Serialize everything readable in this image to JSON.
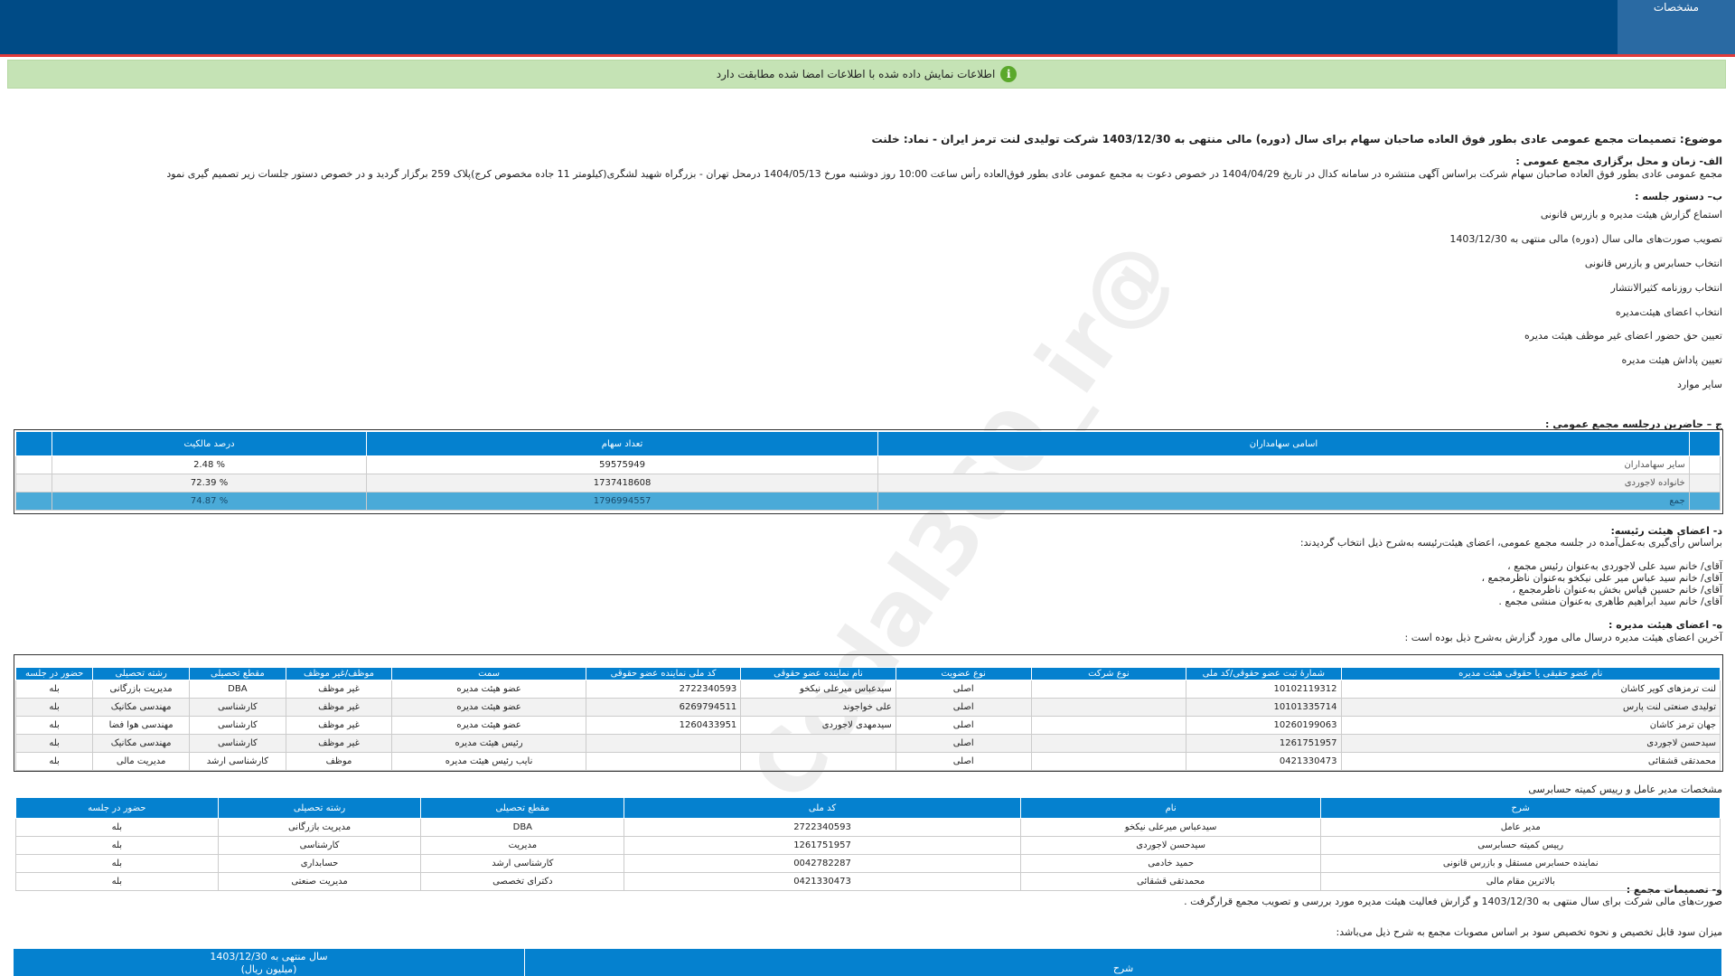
{
  "tab": {
    "label": "مشخصات"
  },
  "notice": {
    "text": "اطلاعات نمایش داده شده با اطلاعات امضا شده مطابقت دارد"
  },
  "subject": "موضوع: تصمیمات مجمع عمومی عادی بطور فوق العاده صاحبان سهام برای سال (دوره) مالی منتهی به 1403/12/30 شرکت تولیدی لنت ترمز ایران - نماد: خلنت",
  "section_a": {
    "heading": "الف- زمان و محل برگزاری مجمع عمومی :",
    "body": "مجمع عمومی عادی بطور فوق العاده صاحبان سهام شرکت براساس آگهی منتشره در سامانه کدال در تاریخ 1404/04/29 در خصوص دعوت به مجمع عمومی عادی بطور فوق‌العاده رأس ساعت 10:00 روز دوشنبه مورخ 1404/05/13 درمحل  تهران - بزرگراه شهید لشگری(کیلومتر 11 جاده مخصوص کرج)پلاک 259   برگزار گردید و در خصوص دستور جلسات زیر تصمیم گیری نمود"
  },
  "section_b": {
    "heading": "ب– دستور جلسه :",
    "items": [
      "استماع گزارش هیئت مدیره و بازرس قانونی",
      "تصویب صورت‌های مالی سال (دوره) مالی منتهی به 1403/12/30",
      "انتخاب حسابرس و بازرس قانونی",
      "انتخاب روزنامه کثیرالانتشار",
      "انتخاب اعضای هیئت‌مدیره",
      "تعیین حق حضور اعضای غیر موظف هیئت مدیره",
      "تعیین پاداش هیئت مدیره",
      "سایر موارد"
    ]
  },
  "section_c": {
    "heading": "ج – حاضرین درجلسه مجمع عمومی :",
    "headers": [
      "اسامی سهامداران",
      "تعداد سهام",
      "درصد مالکیت"
    ],
    "rows": [
      [
        "سایر سهامداران",
        "59575949",
        "% 2.48"
      ],
      [
        "خانواده لاجوردی",
        "1737418608",
        "% 72.39"
      ]
    ],
    "total": [
      "جمع",
      "1796994557",
      "% 74.87"
    ]
  },
  "section_d": {
    "heading": "د- اعضای هیئت رئیسه:",
    "intro": "براساس رأی‌گیری به‌عمل‌آمده در جلسه مجمع عمومی، اعضای هیئت‌رئیسه به‌شرح ذیل انتخاب گردیدند:",
    "members": [
      "آقای/ خانم  سید علی لاجوردی  به‌عنوان رئیس مجمع ،",
      "آقای/ خانم  سید عباس میر علی نیکخو  به‌عنوان ناظرمجمع ،",
      "آقای/ خانم  حسین قیاس بخش  به‌عنوان ناظرمجمع ،",
      "آقای/ خانم  سید ابراهیم طاهری  به‌عنوان منشی مجمع ."
    ]
  },
  "section_e": {
    "heading": "ه- اعضای هیئت مدیره :",
    "intro": "آخرین اعضای هیئت مدیره درسال مالی مورد گزارش به‌شرح ذیل بوده است :",
    "headers": [
      "نام عضو حقیقی یا حقوقی هیئت مدیره",
      "شمارهٔ ثبت عضو حقوقی/کد ملی",
      "نوع شرکت",
      "نوع عضویت",
      "نام نماینده عضو حقوقی",
      "کد ملی نماینده عضو حقوقی",
      "سمت",
      "موظف/غیر موظف",
      "مقطع تحصیلی",
      "رشته تحصیلی",
      "حضور در جلسه"
    ],
    "rows": [
      [
        "لنت ترمزهای کویر کاشان",
        "10102119312",
        "",
        "اصلی",
        "سیدعباس میرعلی نیکخو",
        "2722340593",
        "عضو هیئت مدیره",
        "غیر موظف",
        "DBA",
        "مدیریت بازرگانی",
        "بله"
      ],
      [
        "تولیدی صنعتی لنت پارس",
        "10101335714",
        "",
        "اصلی",
        "علی خواجوند",
        "6269794511",
        "عضو هیئت مدیره",
        "غیر موظف",
        "کارشناسی",
        "مهندسی مکانیک",
        "بله"
      ],
      [
        "جهان ترمز کاشان",
        "10260199063",
        "",
        "اصلی",
        "سیدمهدی لاجوردی",
        "1260433951",
        "عضو هیئت مدیره",
        "غیر موظف",
        "کارشناسی",
        "مهندسی هوا فضا",
        "بله"
      ],
      [
        "سیدحسن لاجوردی",
        "1261751957",
        "",
        "اصلی",
        "",
        "",
        "رئیس هیئت مدیره",
        "غیر موظف",
        "کارشناسی",
        "مهندسی مکانیک",
        "بله"
      ],
      [
        "محمدتقی قشقائی",
        "0421330473",
        "",
        "اصلی",
        "",
        "",
        "نایب رئیس هیئت مدیره",
        "موظف",
        "کارشناسی ارشد",
        "مدیریت مالی",
        "بله"
      ]
    ]
  },
  "ceo_section": {
    "heading": "مشخصات مدیر عامل و رییس کمیته حسابرسی",
    "headers": [
      "شرح",
      "نام",
      "کد ملی",
      "مقطع تحصیلی",
      "رشته تحصیلی",
      "حضور در جلسه"
    ],
    "rows": [
      [
        "مدیر عامل",
        "سیدعباس میرعلی نیکخو",
        "2722340593",
        "DBA",
        "مدیریت بازرگانی",
        "بله"
      ],
      [
        "رییس کمیته حسابرسی",
        "سیدحسن لاجوردی",
        "1261751957",
        "مدیریت",
        "کارشناسی",
        "بله"
      ],
      [
        "نماینده حسابرس مستقل و بازرس قانونی",
        "حمید خادمی",
        "0042782287",
        "کارشناسی ارشد",
        "حسابداری",
        "بله"
      ],
      [
        "بالاترین مقام مالی",
        "محمدتقی قشقائی",
        "0421330473",
        "دکترای تخصصی",
        "مدیریت صنعتی",
        "بله"
      ]
    ]
  },
  "section_f": {
    "heading": "و- تصمیمات مجمع :",
    "body1": "صورت‌های مالی شرکت برای سال منتهی به  1403/12/30 و گزارش فعالیت هیئت مدیره مورد بررسی و تصویب مجمع قرارگرفت .",
    "body2": "میزان سود قابل تخصیص و نحوه تخصیص سود بر اساس مصوبات مجمع به شرح ذیل می‌باشد:"
  },
  "profit_table": {
    "headers": [
      "شرح",
      "سال منتهی به 1403/12/30",
      "(میلیون ریال)"
    ]
  },
  "watermark": "@Codal360_ir"
}
